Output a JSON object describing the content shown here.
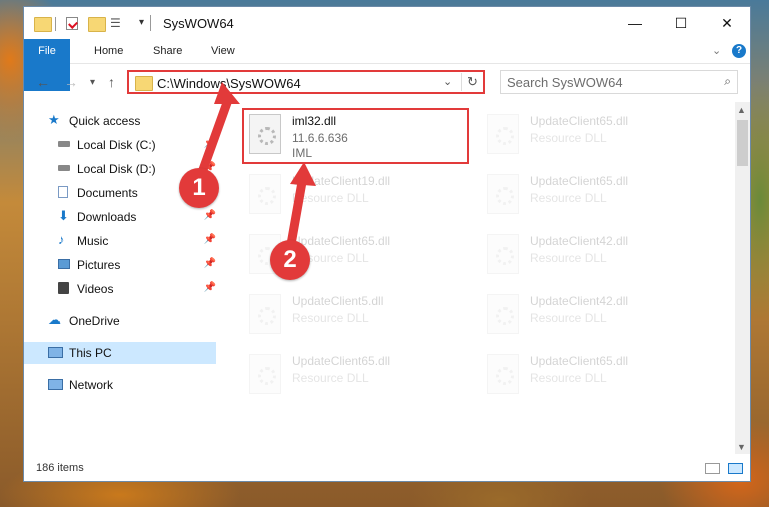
{
  "window": {
    "title": "SysWOW64"
  },
  "ribbon": {
    "tabs": [
      "File",
      "Home",
      "Share",
      "View"
    ]
  },
  "address": {
    "path": "C:\\Windows\\SysWOW64"
  },
  "search": {
    "placeholder": "Search SysWOW64"
  },
  "sidebar": {
    "items": [
      {
        "label": "Quick access",
        "icon": "star-icon"
      },
      {
        "label": "Local Disk (C:)",
        "icon": "drive-icon"
      },
      {
        "label": "Local Disk (D:)",
        "icon": "drive-icon"
      },
      {
        "label": "Documents",
        "icon": "documents-icon"
      },
      {
        "label": "Downloads",
        "icon": "download-icon"
      },
      {
        "label": "Music",
        "icon": "music-icon"
      },
      {
        "label": "Pictures",
        "icon": "pictures-icon"
      },
      {
        "label": "Videos",
        "icon": "videos-icon"
      },
      {
        "label": "OneDrive",
        "icon": "cloud-icon"
      },
      {
        "label": "This PC",
        "icon": "computer-icon"
      },
      {
        "label": "Network",
        "icon": "network-icon"
      }
    ]
  },
  "files": [
    {
      "name": "iml32.dll",
      "line2": "11.6.6.636",
      "line3": "IML"
    },
    {
      "name": "UpdateClient65.dll",
      "line2": "Resource DLL",
      "line3": ""
    },
    {
      "name": "UpdateClient19.dll",
      "line2": "Resource DLL",
      "line3": ""
    },
    {
      "name": "UpdateClient65.dll",
      "line2": "Resource DLL",
      "line3": ""
    },
    {
      "name": "UpdateClient65.dll",
      "line2": "Resource DLL",
      "line3": ""
    },
    {
      "name": "UpdateClient42.dll",
      "line2": "Resource DLL",
      "line3": ""
    },
    {
      "name": "UpdateClient5.dll",
      "line2": "Resource DLL",
      "line3": ""
    },
    {
      "name": "UpdateClient42.dll",
      "line2": "Resource DLL",
      "line3": ""
    },
    {
      "name": "UpdateClient65.dll",
      "line2": "Resource DLL",
      "line3": ""
    },
    {
      "name": "UpdateClient65.dll",
      "line2": "Resource DLL",
      "line3": ""
    }
  ],
  "status": {
    "item_count": "186 items"
  },
  "annotations": [
    "1",
    "2"
  ],
  "colors": {
    "accent": "#1979ca",
    "highlight": "#e23a3a",
    "selected": "#cce8ff"
  }
}
